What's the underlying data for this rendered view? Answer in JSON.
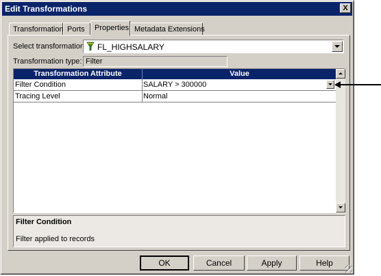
{
  "window": {
    "title": "Edit Transformations",
    "close_label": "X"
  },
  "tabs": [
    {
      "label": "Transformation"
    },
    {
      "label": "Ports"
    },
    {
      "label": "Properties"
    },
    {
      "label": "Metadata Extensions"
    }
  ],
  "form": {
    "select_label": "Select transformation:",
    "select_value": "FL_HIGHSALARY",
    "type_label": "Transformation type:",
    "type_value": "Filter"
  },
  "grid": {
    "columns": [
      "Transformation Attribute",
      "Value"
    ],
    "rows": [
      {
        "attribute": "Filter Condition",
        "value": "SALARY > 300000"
      },
      {
        "attribute": "Tracing Level",
        "value": "Normal"
      }
    ]
  },
  "description": {
    "title": "Filter Condition",
    "text": "Filter applied to records"
  },
  "buttons": {
    "ok": "OK",
    "cancel": "Cancel",
    "apply": "Apply",
    "help": "Help"
  },
  "colors": {
    "titlebar": "#0a246a",
    "dialog_face": "#d4d0c8",
    "header_text": "#ffffff"
  },
  "icons": {
    "transformation": "filter-funnel-icon"
  }
}
